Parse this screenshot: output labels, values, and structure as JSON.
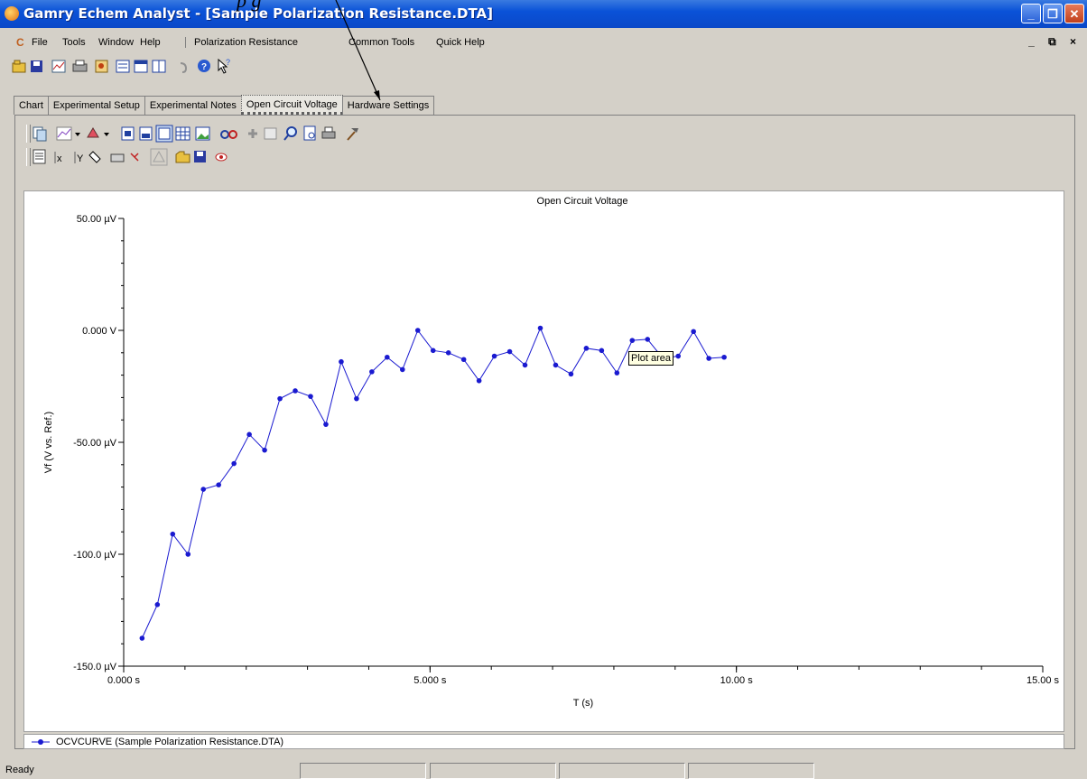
{
  "window": {
    "title": "Gamry Echem Analyst - [Sample Polarization Resistance.DTA]",
    "controls": [
      "minimize",
      "restore",
      "close"
    ]
  },
  "annotation": {
    "caption_fragment": "p                      g"
  },
  "menu": {
    "items": [
      "File",
      "Tools",
      "Window",
      "Help",
      "Polarization Resistance",
      "Common Tools",
      "Quick Help"
    ],
    "mdi_controls": "_ ⧉ ×"
  },
  "tabs": {
    "items": [
      "Chart",
      "Experimental Setup",
      "Experimental Notes",
      "Open Circuit Voltage",
      "Hardware Settings"
    ],
    "active_index": 3
  },
  "toolbar1": {
    "icons": [
      "open-icon",
      "save-icon",
      "chart-icon",
      "print-icon",
      "export-icon",
      "list-icon",
      "list2-icon",
      "columns-icon",
      "undo-icon",
      "help-icon",
      "whats-this-icon"
    ]
  },
  "toolbar2": {
    "icons": [
      "copy-icon",
      "chart-type-icon",
      "color-icon",
      "page-icon",
      "page2-icon",
      "table-icon",
      "grid-icon",
      "image-icon",
      "zoom-glasses-icon",
      "pan-icon",
      "zoom-box-icon",
      "find-icon",
      "page-setup-icon",
      "print-preview-icon",
      "hammer-icon"
    ]
  },
  "toolbar3": {
    "icons": [
      "data-table-icon",
      "x-axis-icon",
      "y-axis-icon",
      "tag-icon",
      "keyboard-icon",
      "cursor-icon",
      "warning-icon",
      "open-folder-icon",
      "save-disk-icon",
      "eye-icon"
    ]
  },
  "tooltip": {
    "text": "Plot area"
  },
  "chart_data": {
    "type": "line",
    "title": "Open Circuit Voltage",
    "xlabel": "T (s)",
    "ylabel": "Vf (V vs. Ref.)",
    "xlim": [
      0,
      15
    ],
    "ylim": [
      -150,
      50
    ],
    "x_ticks": [
      0,
      5,
      10,
      15
    ],
    "x_tick_labels": [
      "0.000 s",
      "5.000 s",
      "10.00 s",
      "15.00 s"
    ],
    "y_ticks": [
      50,
      0,
      -50,
      -100,
      -150
    ],
    "y_tick_labels": [
      "50.00 µV",
      "0.000 V",
      "-50.00 µV",
      "-100.0 µV",
      "-150.0 µV"
    ],
    "grid": false,
    "series": [
      {
        "name": "OCVCURVE (Sample Polarization Resistance.DTA)",
        "color": "#1a1ad0",
        "x": [
          0.3,
          0.55,
          0.8,
          1.05,
          1.3,
          1.55,
          1.8,
          2.05,
          2.3,
          2.55,
          2.8,
          3.05,
          3.3,
          3.55,
          3.8,
          4.05,
          4.3,
          4.55,
          4.8,
          5.05,
          5.3,
          5.55,
          5.8,
          6.05,
          6.3,
          6.55,
          6.8,
          7.05,
          7.3,
          7.55,
          7.8,
          8.05,
          8.3,
          8.55,
          8.8,
          9.05,
          9.3,
          9.55,
          9.8,
          10.05
        ],
        "y": [
          -137.5,
          -122.5,
          -91,
          -100,
          -71,
          -69,
          -59.5,
          -46.5,
          -53.5,
          -30.5,
          -27,
          -29.5,
          -42,
          -14,
          -30.5,
          -18.5,
          -12,
          -17.5,
          0,
          -9,
          -10,
          -13,
          -22.5,
          -11.5,
          -9.5,
          -15.5,
          1,
          -15.5,
          -19.5,
          -8,
          -9,
          -19,
          -4.5,
          -4,
          -12.5,
          -11.5,
          -0.5,
          -12.5,
          -12,
          null
        ]
      }
    ]
  },
  "legend": {
    "placement": "bottom-left"
  },
  "status": {
    "text": "Ready"
  }
}
